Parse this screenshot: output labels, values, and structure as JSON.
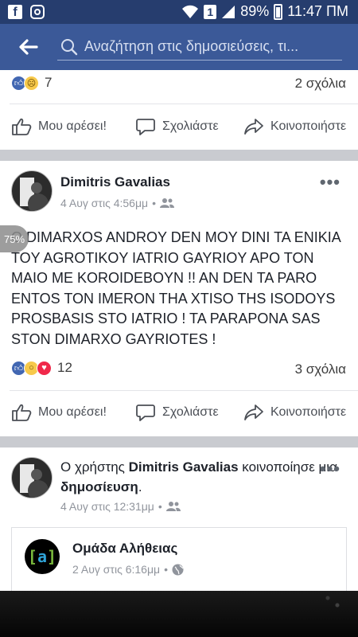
{
  "status_bar": {
    "battery": "89%",
    "time": "11:47 ΠΜ",
    "sim_slot": "1"
  },
  "header": {
    "search_placeholder": "Αναζήτηση στις δημοσιεύσεις, τι..."
  },
  "colors": {
    "status_bar": "#263d6e",
    "header": "#3b5998",
    "like_blue": "#4267b2",
    "love_red": "#f0284a",
    "haha_yellow": "#f7c94b"
  },
  "posts": [
    {
      "reaction_icons": [
        "like-icon",
        "sad-icon"
      ],
      "reaction_count": "7",
      "comments": "2 σχόλια"
    },
    {
      "author": "Dimitris Gavalias",
      "time": "4 Αυγ στις 4:56μμ",
      "privacy": "friends-icon",
      "text": "Ο DIMARXOS ANDROY DEN MOY DINI TA ENIKIA  TOY  AGROTIKOY IATRIO GAYRIOY APO TON MAIO ME KOROIDEBOYN !! AN DEN TA PARO ENTOS TON IMERON THA XTISO THS ISODOYS PROSBASIS STO IATRIO ! TA PARAPONA SAS STON DIMARXO GAYRIOTES !",
      "reaction_icons": [
        "like-icon",
        "wow-icon",
        "love-icon"
      ],
      "reaction_count": "12",
      "comments": "3 σχόλια"
    },
    {
      "share_prefix": "Ο χρήστης",
      "author": "Dimitris Gavalias",
      "share_middle": "κοινοποίησε μια",
      "share_object": "δημοσίευση",
      "share_suffix": ".",
      "time": "4 Αυγ στις 12:31μμ",
      "shared": {
        "page_name": "Ομάδα Αλήθειας",
        "time": "2 Αυγ στις 6:16μμ",
        "logo_left": "[",
        "logo_mid": "a",
        "logo_right": "]"
      }
    }
  ],
  "actions": {
    "like": "Μου αρέσει!",
    "comment": "Σχολιάστε",
    "share": "Κοινοποιήστε"
  },
  "more_label": "•••",
  "overlay_badge": "75%"
}
